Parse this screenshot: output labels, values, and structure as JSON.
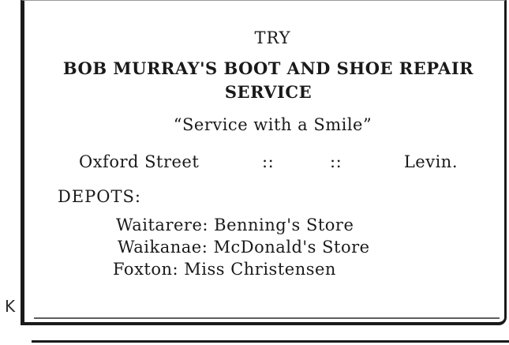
{
  "advert": {
    "intro": "TRY",
    "headline": "BOB MURRAY'S BOOT AND SHOE REPAIR SERVICE",
    "slogan": "“Service with a Smile”",
    "address": {
      "street": "Oxford Street",
      "separator_1": "::",
      "separator_2": "::",
      "town": "Levin."
    },
    "depots_heading": "DEPOTS:",
    "depots": [
      "Waitarere: Benning's Store",
      "Waikanae: McDonald's Store",
      "Foxton: Miss Christensen"
    ]
  },
  "margin_mark": "K"
}
